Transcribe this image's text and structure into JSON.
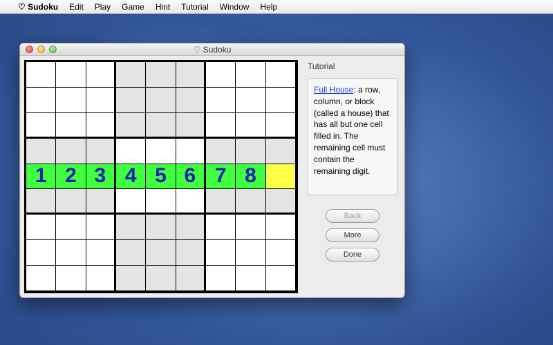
{
  "menubar": {
    "apple": "",
    "app_name": "♡ Sudoku",
    "items": [
      "Edit",
      "Play",
      "Game",
      "Hint",
      "Tutorial",
      "Window",
      "Help"
    ]
  },
  "window": {
    "title": "♡ Sudoku"
  },
  "sudoku": {
    "highlight_row": 4,
    "row_values": [
      "1",
      "2",
      "3",
      "4",
      "5",
      "6",
      "7",
      "8",
      ""
    ],
    "green_cols": [
      0,
      1,
      2,
      3,
      4,
      5,
      6,
      7
    ],
    "yellow_cols": [
      8
    ]
  },
  "sidebar": {
    "section_label": "Tutorial",
    "link_text": "Full House",
    "body_rest": ": a row, column, or block (called a house) that has all but one cell filled in. The remaining cell must contain the remaining digit.",
    "buttons": {
      "back": "Back",
      "more": "More",
      "done": "Done"
    }
  }
}
